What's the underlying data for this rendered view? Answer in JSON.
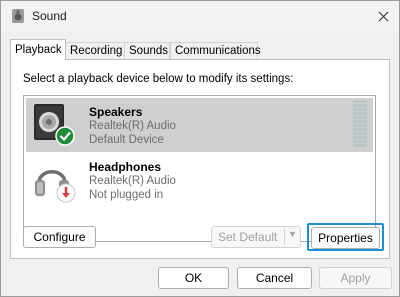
{
  "window": {
    "title": "Sound"
  },
  "tabs": [
    {
      "label": "Playback",
      "active": true
    },
    {
      "label": "Recording",
      "active": false
    },
    {
      "label": "Sounds",
      "active": false
    },
    {
      "label": "Communications",
      "active": false
    }
  ],
  "playback": {
    "instruction": "Select a playback device below to modify its settings:",
    "devices": [
      {
        "name": "Speakers",
        "driver": "Realtek(R) Audio",
        "status": "Default Device",
        "selected": true,
        "status_icon": "check-badge-icon",
        "icon": "speaker-icon"
      },
      {
        "name": "Headphones",
        "driver": "Realtek(R) Audio",
        "status": "Not plugged in",
        "selected": false,
        "status_icon": "unplugged-arrow-icon",
        "icon": "headphones-icon"
      }
    ],
    "configure_label": "Configure",
    "set_default_label": "Set Default",
    "properties_label": "Properties"
  },
  "footer": {
    "ok_label": "OK",
    "cancel_label": "Cancel",
    "apply_label": "Apply"
  },
  "colors": {
    "highlight": "#1a8fd6",
    "check_badge": "#1e8c3a",
    "unplugged_badge": "#d83b3b",
    "selection": "#cfcfcf"
  }
}
